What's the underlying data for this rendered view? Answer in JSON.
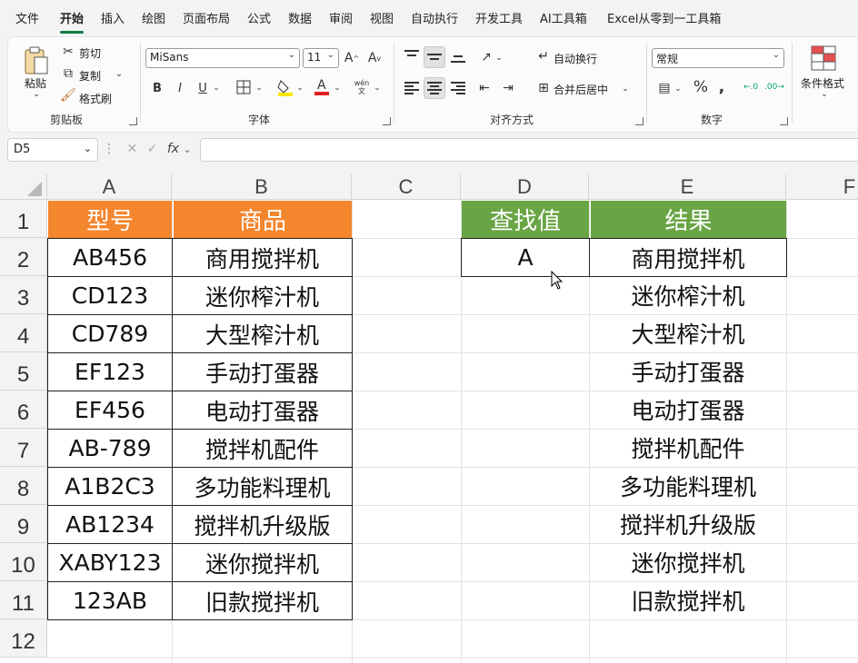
{
  "menu": {
    "items": [
      {
        "label": "文件"
      },
      {
        "label": "开始"
      },
      {
        "label": "插入"
      },
      {
        "label": "绘图"
      },
      {
        "label": "页面布局"
      },
      {
        "label": "公式"
      },
      {
        "label": "数据"
      },
      {
        "label": "审阅"
      },
      {
        "label": "视图"
      },
      {
        "label": "自动执行"
      },
      {
        "label": "开发工具"
      },
      {
        "label": "AI工具箱"
      },
      {
        "label": "Excel从零到一工具箱"
      }
    ],
    "active": "开始"
  },
  "ribbon": {
    "clipboard": {
      "paste": "粘贴",
      "cut": "剪切",
      "copy": "复制",
      "format_painter": "格式刷",
      "group": "剪贴板"
    },
    "font": {
      "name": "MiSans",
      "size": "11",
      "group": "字体",
      "phonetic": "wén"
    },
    "alignment": {
      "wrap": "自动换行",
      "merge": "合并后居中",
      "group": "对齐方式"
    },
    "number": {
      "format": "常规",
      "group": "数字"
    },
    "styles": {
      "conditional": "条件格式"
    }
  },
  "formula_bar": {
    "name_box": "D5",
    "formula": ""
  },
  "grid": {
    "columns": [
      "A",
      "B",
      "C",
      "D",
      "E",
      "F"
    ],
    "rows": [
      "1",
      "2",
      "3",
      "4",
      "5",
      "6",
      "7",
      "8",
      "9",
      "10",
      "11",
      "12"
    ],
    "table1": {
      "headers": [
        "型号",
        "商品"
      ],
      "rows": [
        [
          "AB456",
          "商用搅拌机"
        ],
        [
          "CD123",
          "迷你榨汁机"
        ],
        [
          "CD789",
          "大型榨汁机"
        ],
        [
          "EF123",
          "手动打蛋器"
        ],
        [
          "EF456",
          "电动打蛋器"
        ],
        [
          "AB-789",
          "搅拌机配件"
        ],
        [
          "A1B2C3",
          "多功能料理机"
        ],
        [
          "AB1234",
          "搅拌机升级版"
        ],
        [
          "XABY123",
          "迷你搅拌机"
        ],
        [
          "123AB",
          "旧款搅拌机"
        ]
      ]
    },
    "lookup": {
      "header": "查找值",
      "value": "A"
    },
    "result": {
      "header": "结果",
      "values": [
        "商用搅拌机",
        "迷你榨汁机",
        "大型榨汁机",
        "手动打蛋器",
        "电动打蛋器",
        "搅拌机配件",
        "多功能料理机",
        "搅拌机升级版",
        "迷你搅拌机",
        "旧款搅拌机"
      ]
    },
    "colors": {
      "orange": "#f4862e",
      "green": "#6aa545"
    }
  }
}
